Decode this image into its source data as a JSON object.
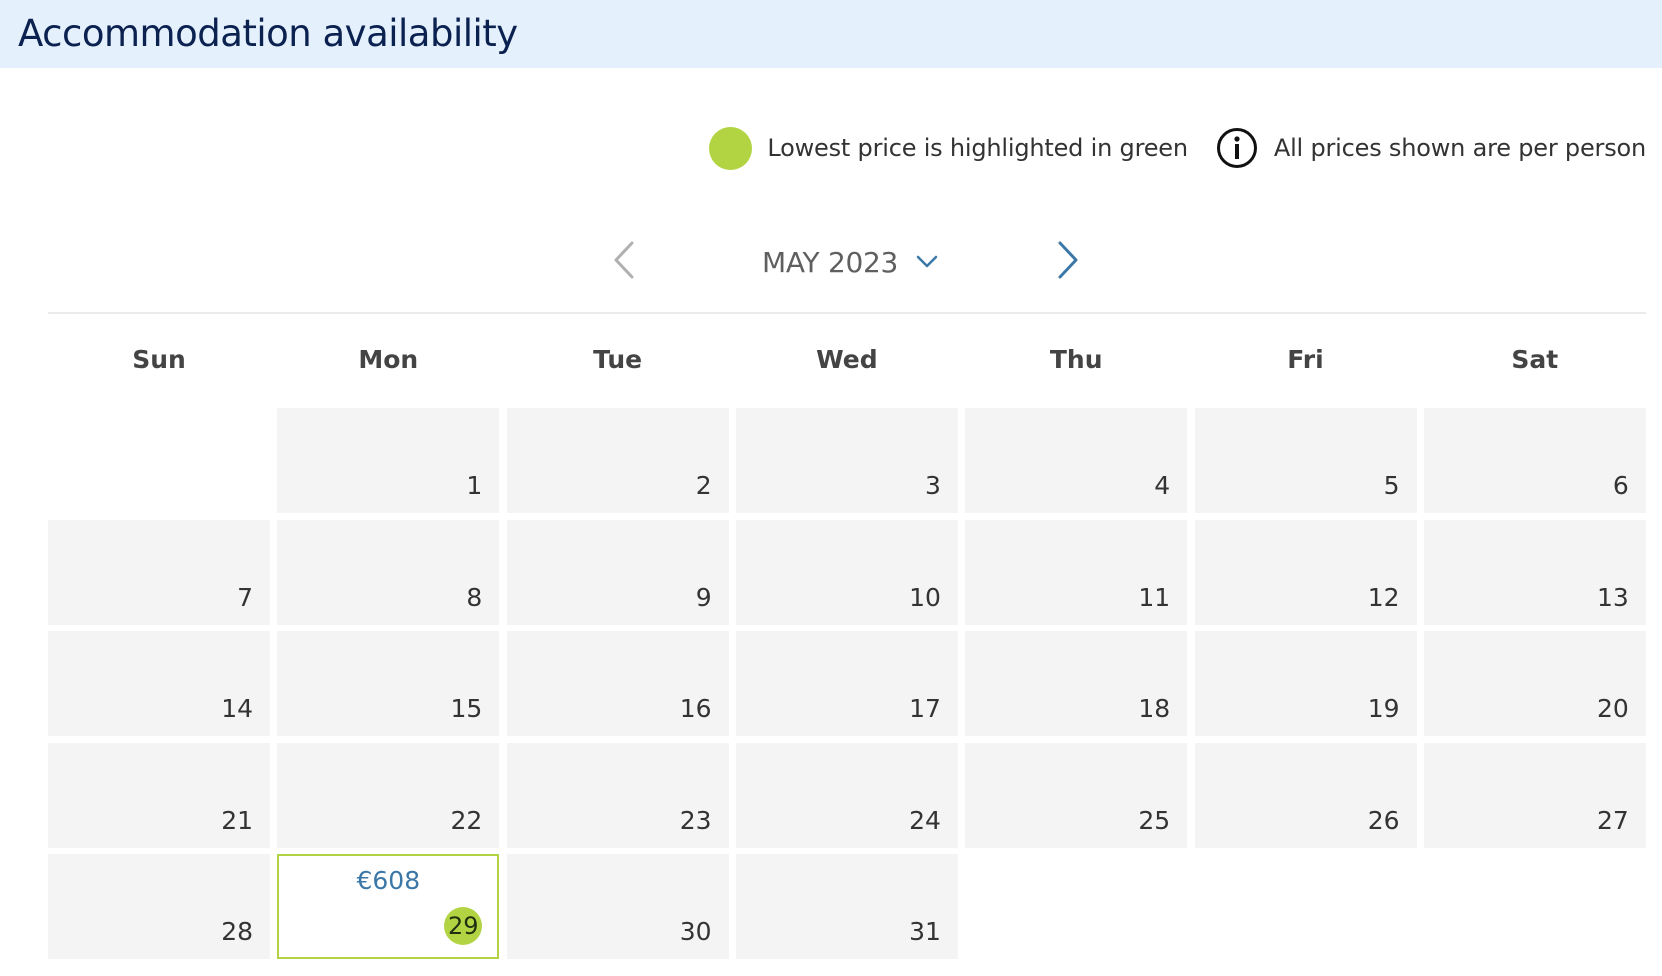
{
  "header": {
    "title": "Accommodation availability"
  },
  "legend": {
    "lowest_price_text": "Lowest price is highlighted in green",
    "per_person_text": "All prices shown are per person",
    "highlight_color": "#b2d443"
  },
  "month_nav": {
    "month_label": "MAY 2023",
    "prev_icon": "chevron-left-icon",
    "next_icon": "chevron-right-icon",
    "dropdown_icon": "chevron-down-icon"
  },
  "weekdays": [
    "Sun",
    "Mon",
    "Tue",
    "Wed",
    "Thu",
    "Fri",
    "Sat"
  ],
  "calendar": {
    "first_weekday_index": 1,
    "days_in_month": 31,
    "priced_days": {
      "29": {
        "price": "€608",
        "lowest": true
      }
    }
  },
  "colors": {
    "accent_blue": "#3b78a8",
    "header_bg": "#e4f0fc",
    "cell_bg": "#f4f4f4"
  }
}
